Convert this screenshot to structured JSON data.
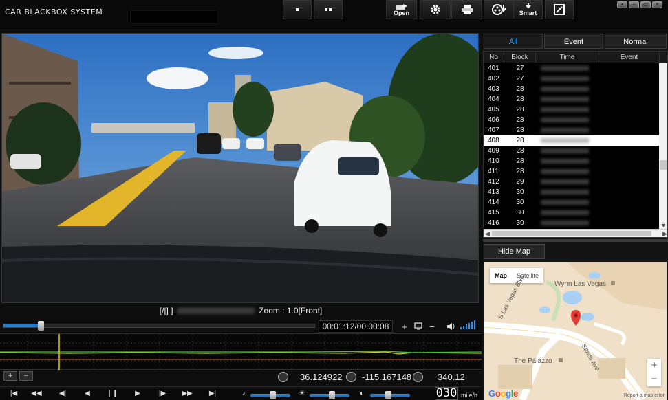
{
  "app": {
    "title": "CAR BLACKBOX SYSTEM"
  },
  "toolbar": {
    "open_label": "Open",
    "smart_label": "Smart",
    "icons": [
      "layout-single-icon",
      "layout-dual-icon",
      "open-icon",
      "settings-icon",
      "print-icon",
      "film-download-icon",
      "smart-icon",
      "screenshot-icon"
    ]
  },
  "window_controls": [
    "info-icon",
    "minimize-icon",
    "restore-icon",
    "close-icon"
  ],
  "video": {
    "info_prefix": "[/|] ]",
    "zoom_text": "Zoom : 1.0[Front]"
  },
  "playback": {
    "progress": 0.12,
    "time_display": "00:01:12/00:00:08"
  },
  "gps": {
    "latitude": "36.124922",
    "longitude": "-115.167148",
    "heading": "340.12"
  },
  "speed": {
    "value": "030",
    "unit": "mile/h"
  },
  "sliders": {
    "volume": 0.55,
    "brightness": 0.55,
    "contrast": 0.45
  },
  "tabs": [
    {
      "label": "All",
      "active": true
    },
    {
      "label": "Event",
      "active": false
    },
    {
      "label": "Normal",
      "active": false
    }
  ],
  "list": {
    "columns": [
      "No",
      "Block",
      "Time",
      "Event"
    ],
    "rows": [
      {
        "no": "401",
        "block": "27"
      },
      {
        "no": "402",
        "block": "27"
      },
      {
        "no": "403",
        "block": "28"
      },
      {
        "no": "404",
        "block": "28"
      },
      {
        "no": "405",
        "block": "28"
      },
      {
        "no": "406",
        "block": "28"
      },
      {
        "no": "407",
        "block": "28"
      },
      {
        "no": "408",
        "block": "28",
        "selected": true
      },
      {
        "no": "409",
        "block": "28"
      },
      {
        "no": "410",
        "block": "28"
      },
      {
        "no": "411",
        "block": "28"
      },
      {
        "no": "412",
        "block": "29"
      },
      {
        "no": "413",
        "block": "30"
      },
      {
        "no": "414",
        "block": "30"
      },
      {
        "no": "415",
        "block": "30"
      },
      {
        "no": "416",
        "block": "30"
      }
    ]
  },
  "map": {
    "hide_label": "Hide Map",
    "type_map": "Map",
    "type_satellite": "Satellite",
    "labels": {
      "wynn": "Wynn Las Vegas",
      "blvd": "S Las Vegas Blvd",
      "palazzo": "The Palazzo",
      "sands": "Sands Ave"
    },
    "google": "Google",
    "report": "Report a map error",
    "zoom_in": "+",
    "zoom_out": "−"
  },
  "controls": {
    "zoom_in": "+",
    "zoom_out": "−",
    "graph_plus": "+",
    "graph_minus": "−"
  }
}
